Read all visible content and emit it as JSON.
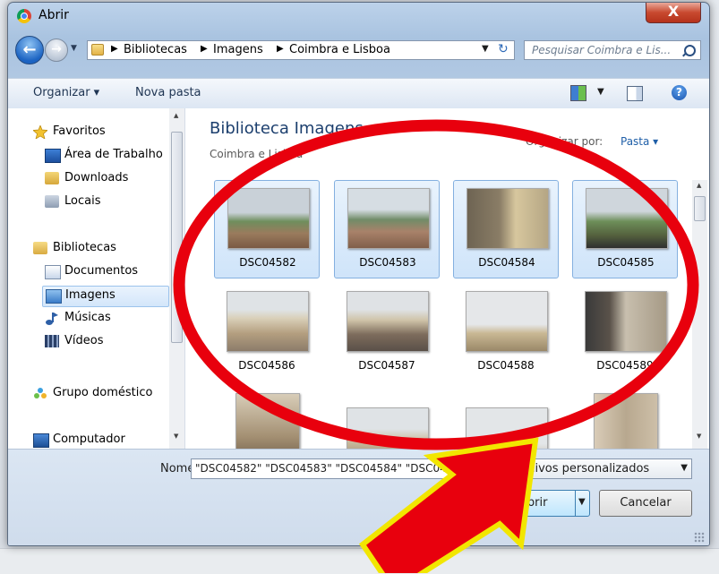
{
  "window": {
    "title": "Abrir",
    "close_glyph": "X"
  },
  "nav": {
    "back_glyph": "←",
    "breadcrumbs": [
      "Bibliotecas",
      "Imagens",
      "Coimbra e Lisboa"
    ],
    "search_placeholder": "Pesquisar Coimbra e Lis..."
  },
  "toolbar": {
    "organize": "Organizar ▾",
    "new_folder": "Nova pasta",
    "help": "?"
  },
  "sidebar": {
    "items": [
      {
        "label": "Favoritos",
        "icon": "star-icon"
      },
      {
        "label": "Área de Trabalho",
        "icon": "desktop-icon"
      },
      {
        "label": "Downloads",
        "icon": "downloads-icon"
      },
      {
        "label": "Locais",
        "icon": "recent-places-icon"
      },
      {
        "label": "Bibliotecas",
        "icon": "libraries-icon"
      },
      {
        "label": "Documentos",
        "icon": "documents-icon"
      },
      {
        "label": "Imagens",
        "icon": "pictures-icon",
        "selected": true
      },
      {
        "label": "Músicas",
        "icon": "music-icon"
      },
      {
        "label": "Vídeos",
        "icon": "videos-icon"
      },
      {
        "label": "Grupo doméstico",
        "icon": "homegroup-icon"
      },
      {
        "label": "Computador",
        "icon": "computer-icon"
      }
    ]
  },
  "content": {
    "title": "Biblioteca Imagens",
    "subtitle": "Coimbra e Lisboa",
    "arrange_label": "Organizar por:",
    "arrange_value": "Pasta ▾",
    "files": [
      {
        "name": "DSC04582",
        "selected": true
      },
      {
        "name": "DSC04583",
        "selected": true
      },
      {
        "name": "DSC04584",
        "selected": true
      },
      {
        "name": "DSC04585",
        "selected": true
      },
      {
        "name": "DSC04586",
        "selected": false
      },
      {
        "name": "DSC04587",
        "selected": false
      },
      {
        "name": "DSC04588",
        "selected": false
      },
      {
        "name": "DSC04589",
        "selected": false
      }
    ]
  },
  "footer": {
    "name_label": "Nome:",
    "name_value": "\"DSC04582\" \"DSC04583\" \"DSC04584\" \"DSC0458",
    "filter_value": "Arquivos personalizados",
    "open_label": "Abrir",
    "cancel_label": "Cancelar"
  },
  "colors": {
    "annotation_red": "#e8000d",
    "annotation_yellow": "#f2e600",
    "selection_blue": "#cfe4fa"
  }
}
